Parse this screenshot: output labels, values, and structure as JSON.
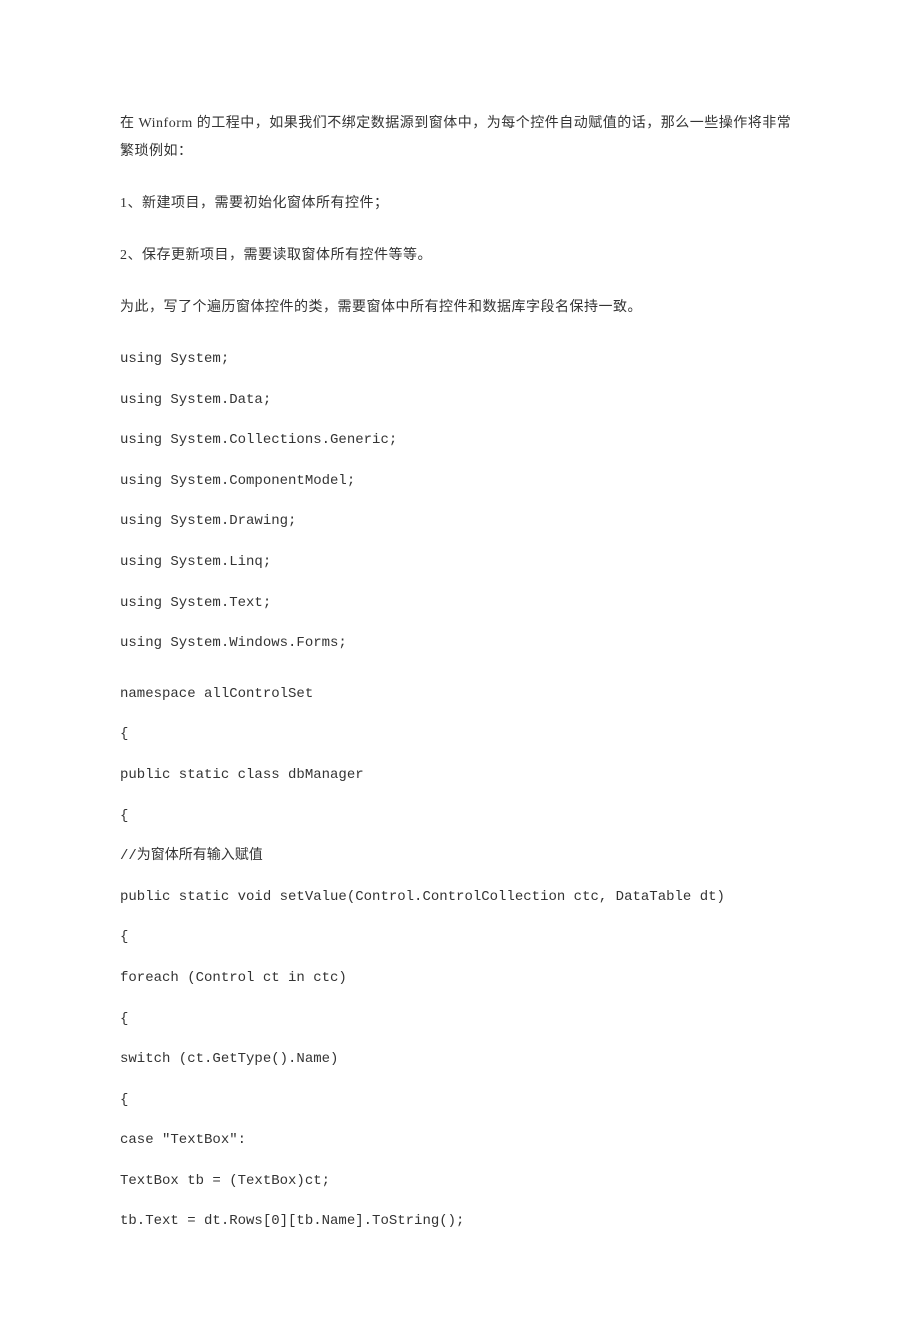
{
  "paragraphs": {
    "p1": "在 Winform 的工程中，如果我们不绑定数据源到窗体中，为每个控件自动赋值的话，那么一些操作将非常繁琐例如：",
    "p2": "1、新建项目，需要初始化窗体所有控件；",
    "p3": "2、保存更新项目，需要读取窗体所有控件等等。",
    "p4": "为此，写了个遍历窗体控件的类，需要窗体中所有控件和数据库字段名保持一致。"
  },
  "code": {
    "l1": "using System;",
    "l2": "using System.Data;",
    "l3": "using System.Collections.Generic;",
    "l4": "using System.ComponentModel;",
    "l5": "using System.Drawing;",
    "l6": "using System.Linq;",
    "l7": "using System.Text;",
    "l8": "using System.Windows.Forms;",
    "l9": "namespace allControlSet",
    "l10": "{",
    "l11": "public static class dbManager",
    "l12": "{",
    "l13": "//为窗体所有输入赋值",
    "l14": "public static void setValue(Control.ControlCollection ctc, DataTable dt)",
    "l15": "{",
    "l16": "foreach (Control ct in ctc)",
    "l17": "{",
    "l18": "switch (ct.GetType().Name)",
    "l19": "{",
    "l20": "case \"TextBox\":",
    "l21": "TextBox tb = (TextBox)ct;",
    "l22": "tb.Text = dt.Rows[0][tb.Name].ToString();"
  }
}
